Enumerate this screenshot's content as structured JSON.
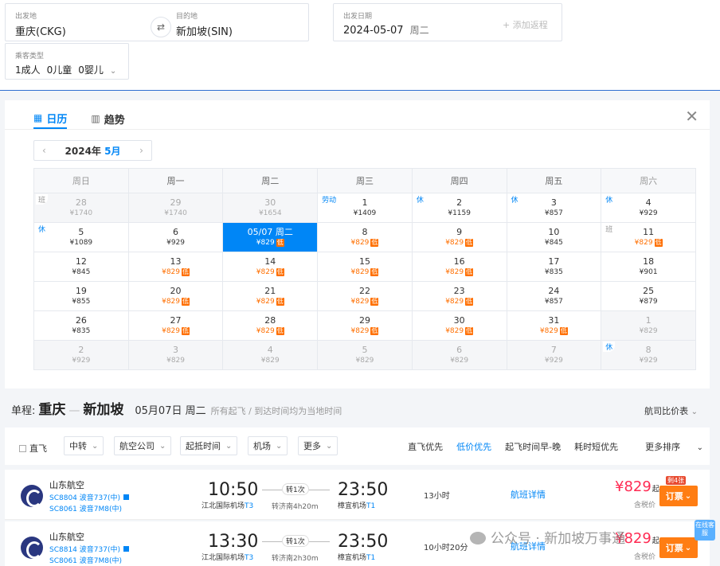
{
  "search": {
    "from": {
      "label": "出发地",
      "value": "重庆(CKG)"
    },
    "to": {
      "label": "目的地",
      "value": "新加坡(SIN)"
    },
    "date": {
      "label": "出发日期",
      "value": "2024-05-07",
      "weekday": "周二"
    },
    "add_trip": "+ 添加返程",
    "passenger": {
      "label": "乘客类型",
      "adult": "1成人",
      "child": "0儿童",
      "infant": "0婴儿"
    }
  },
  "calendar_panel": {
    "tabs": [
      {
        "label": "日历",
        "active": true,
        "icon": "calendar-icon"
      },
      {
        "label": "趋势",
        "active": false,
        "icon": "chart-icon"
      }
    ],
    "year": "2024年",
    "month": "5月",
    "weekdays": [
      "周日",
      "周一",
      "周二",
      "周三",
      "周四",
      "周五",
      "周六"
    ],
    "weeks": [
      [
        {
          "d": "28",
          "p": "¥1740",
          "out": true,
          "tag": "班"
        },
        {
          "d": "29",
          "p": "¥1740",
          "out": true
        },
        {
          "d": "30",
          "p": "¥1654",
          "out": true
        },
        {
          "d": "1",
          "p": "¥1409",
          "tag": "劳动"
        },
        {
          "d": "2",
          "p": "¥1159",
          "tag": "休"
        },
        {
          "d": "3",
          "p": "¥857",
          "tag": "休"
        },
        {
          "d": "4",
          "p": "¥929",
          "tag": "休"
        }
      ],
      [
        {
          "d": "5",
          "p": "¥1089",
          "tag": "休"
        },
        {
          "d": "6",
          "p": "¥929"
        },
        {
          "d": "05/07 周二",
          "p": "¥829",
          "sel": true,
          "low": true
        },
        {
          "d": "8",
          "p": "¥829",
          "low": true
        },
        {
          "d": "9",
          "p": "¥829",
          "low": true
        },
        {
          "d": "10",
          "p": "¥845"
        },
        {
          "d": "11",
          "p": "¥829",
          "low": true,
          "tag": "班"
        }
      ],
      [
        {
          "d": "12",
          "p": "¥845"
        },
        {
          "d": "13",
          "p": "¥829",
          "low": true
        },
        {
          "d": "14",
          "p": "¥829",
          "low": true
        },
        {
          "d": "15",
          "p": "¥829",
          "low": true
        },
        {
          "d": "16",
          "p": "¥829",
          "low": true
        },
        {
          "d": "17",
          "p": "¥835"
        },
        {
          "d": "18",
          "p": "¥901"
        }
      ],
      [
        {
          "d": "19",
          "p": "¥855"
        },
        {
          "d": "20",
          "p": "¥829",
          "low": true
        },
        {
          "d": "21",
          "p": "¥829",
          "low": true
        },
        {
          "d": "22",
          "p": "¥829",
          "low": true
        },
        {
          "d": "23",
          "p": "¥829",
          "low": true
        },
        {
          "d": "24",
          "p": "¥857"
        },
        {
          "d": "25",
          "p": "¥879"
        }
      ],
      [
        {
          "d": "26",
          "p": "¥835"
        },
        {
          "d": "27",
          "p": "¥829",
          "low": true
        },
        {
          "d": "28",
          "p": "¥829",
          "low": true
        },
        {
          "d": "29",
          "p": "¥829",
          "low": true
        },
        {
          "d": "30",
          "p": "¥829",
          "low": true
        },
        {
          "d": "31",
          "p": "¥829",
          "low": true
        },
        {
          "d": "1",
          "p": "¥829",
          "out": true
        }
      ],
      [
        {
          "d": "2",
          "p": "¥929",
          "out": true
        },
        {
          "d": "3",
          "p": "¥829",
          "out": true
        },
        {
          "d": "4",
          "p": "¥829",
          "out": true
        },
        {
          "d": "5",
          "p": "¥829",
          "out": true
        },
        {
          "d": "6",
          "p": "¥829",
          "out": true
        },
        {
          "d": "7",
          "p": "¥929",
          "out": true
        },
        {
          "d": "8",
          "p": "¥929",
          "out": true,
          "tag": "休"
        }
      ]
    ],
    "low_label": "低"
  },
  "route": {
    "prefix": "单程:",
    "from_city": "重庆",
    "to_city": "新加坡",
    "date": "05月07日 周二",
    "note": "所有起飞 / 到达时间均为当地时间",
    "compare": "航司比价表"
  },
  "filters": {
    "direct": "直飞",
    "dropdowns": [
      "中转",
      "航空公司",
      "起抵时间",
      "机场",
      "更多"
    ],
    "sorts": [
      {
        "label": "直飞优先",
        "on": false
      },
      {
        "label": "低价优先",
        "on": true
      },
      {
        "label": "起飞时间早-晚",
        "on": false
      },
      {
        "label": "耗时短优先",
        "on": false
      },
      {
        "label": "更多排序",
        "on": false
      }
    ]
  },
  "flights": [
    {
      "airline": "山东航空",
      "code1": "SC8804 波音737(中)",
      "code2": "SC8061 波音7M8(中)",
      "dep": "10:50",
      "dep_ap": "江北国际机场",
      "dep_t": "T3",
      "stops": "转1次",
      "transfer": "转济南4h20m",
      "arr": "23:50",
      "arr_ap": "樟宜机场",
      "arr_t": "T1",
      "dur": "13小时",
      "detail": "航班详情",
      "price": "¥829",
      "price_suffix": "起",
      "tax": "含税价",
      "book": "订票",
      "remain": "剩4张"
    },
    {
      "airline": "山东航空",
      "code1": "SC8814 波音737(中)",
      "code2": "SC8061 波音7M8(中)",
      "dep": "13:30",
      "dep_ap": "江北国际机场",
      "dep_t": "T3",
      "stops": "转1次",
      "transfer": "转济南2h30m",
      "arr": "23:50",
      "arr_ap": "樟宜机场",
      "arr_t": "T1",
      "dur": "10小时20分",
      "detail": "航班详情",
      "price": "¥829",
      "price_suffix": "起",
      "tax": "含税价",
      "book": "订票",
      "remain": ""
    }
  ],
  "online_service": "在线客服",
  "watermark": "公众号 · 新加坡万事通"
}
